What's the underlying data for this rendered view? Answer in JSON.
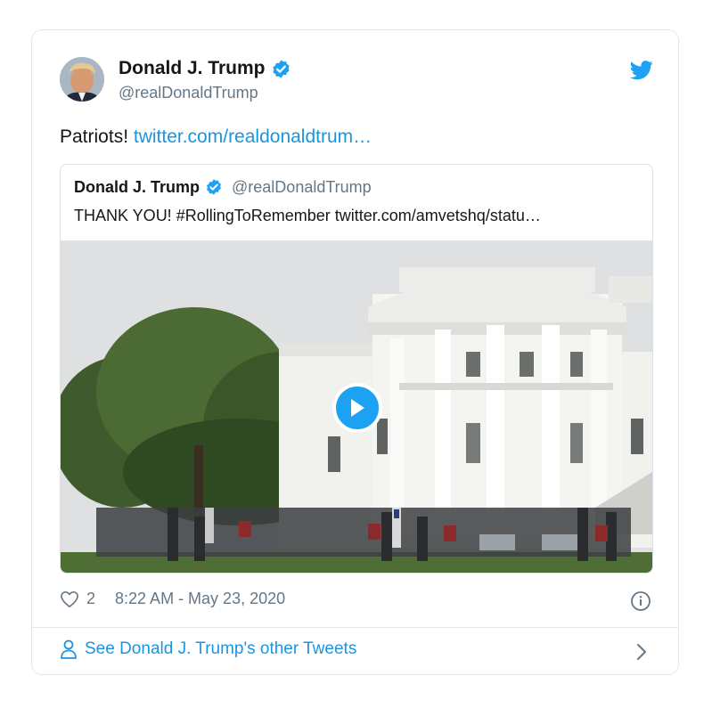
{
  "author": {
    "name": "Donald J. Trump",
    "handle": "@realDonaldTrump",
    "avatar_icon": "avatar-portrait",
    "verified": true
  },
  "tweet": {
    "text": "Patriots!",
    "link": "twitter.com/realdonaldtrum…"
  },
  "quoted_tweet": {
    "name": "Donald J. Trump",
    "handle": "@realDonaldTrump",
    "text": "THANK YOU! #RollingToRemember twitter.com/amvetshq/statu…",
    "media_icon": "video-thumbnail"
  },
  "meta": {
    "likes": "2",
    "timestamp": "8:22 AM - May 23, 2020"
  },
  "footer": {
    "see_more": "See Donald J. Trump's other Tweets"
  },
  "colors": {
    "brand": "#1da1f2",
    "link": "#1b95e0",
    "muted": "#657786",
    "border": "#e1e8ed"
  }
}
